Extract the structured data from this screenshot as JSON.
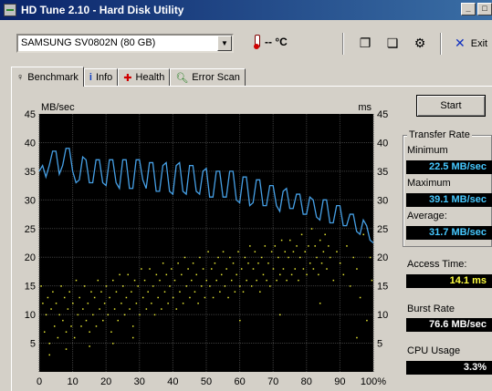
{
  "window": {
    "title": "HD Tune 2.10 - Hard Disk Utility",
    "minimize": "_",
    "maximize": "□"
  },
  "toolbar": {
    "drive": "SAMSUNG SV0802N (80 GB)",
    "temperature": "-- °C",
    "exit_label": "Exit"
  },
  "tabs": [
    {
      "label": "Benchmark",
      "icon": "benchmark-icon",
      "active": true
    },
    {
      "label": "Info",
      "icon": "info-icon"
    },
    {
      "label": "Health",
      "icon": "health-icon"
    },
    {
      "label": "Error Scan",
      "icon": "magnifier-icon"
    }
  ],
  "controls": {
    "start_label": "Start"
  },
  "stats": {
    "transfer_rate_title": "Transfer Rate",
    "minimum_label": "Minimum",
    "minimum_value": "22.5 MB/sec",
    "maximum_label": "Maximum",
    "maximum_value": "39.1 MB/sec",
    "average_label": "Average:",
    "average_value": "31.7 MB/sec",
    "access_time_label": "Access Time:",
    "access_time_value": "14.1 ms",
    "burst_rate_label": "Burst Rate",
    "burst_rate_value": "76.6 MB/sec",
    "cpu_usage_label": "CPU Usage",
    "cpu_usage_value": "3.3%"
  },
  "chart_data": {
    "type": "line",
    "ylabel_left": "MB/sec",
    "ylabel_right": "ms",
    "ylim": [
      0,
      45
    ],
    "yticks": [
      5,
      10,
      15,
      20,
      25,
      30,
      35,
      40,
      45
    ],
    "y2lim": [
      0,
      45
    ],
    "y2ticks": [
      5,
      10,
      15,
      20,
      25,
      30,
      35,
      40,
      45
    ],
    "xlim": [
      0,
      100
    ],
    "xticks": [
      "0",
      "10",
      "20",
      "30",
      "40",
      "50",
      "60",
      "70",
      "80",
      "90",
      "100%"
    ],
    "grid": true,
    "background": "#000000",
    "series": [
      {
        "color": "#46a0e6",
        "x": [
          0,
          1,
          2,
          3,
          4,
          5,
          6,
          7,
          8,
          9,
          10,
          11,
          12,
          13,
          14,
          15,
          16,
          17,
          18,
          19,
          20,
          21,
          22,
          23,
          24,
          25,
          26,
          27,
          28,
          29,
          30,
          31,
          32,
          33,
          34,
          35,
          36,
          37,
          38,
          39,
          40,
          41,
          42,
          43,
          44,
          45,
          46,
          47,
          48,
          49,
          50,
          51,
          52,
          53,
          54,
          55,
          56,
          57,
          58,
          59,
          60,
          61,
          62,
          63,
          64,
          65,
          66,
          67,
          68,
          69,
          70,
          71,
          72,
          73,
          74,
          75,
          76,
          77,
          78,
          79,
          80,
          81,
          82,
          83,
          84,
          85,
          86,
          87,
          88,
          89,
          90,
          91,
          92,
          93,
          94,
          95,
          96,
          97,
          98,
          99,
          100
        ],
        "values": [
          35,
          36,
          34,
          36,
          38.5,
          38.5,
          34.5,
          36,
          39,
          39,
          35,
          33,
          33.5,
          37.5,
          37,
          33,
          33,
          37,
          37,
          33,
          32.5,
          37,
          37,
          33,
          32,
          37,
          37,
          32,
          32,
          37,
          37,
          33.5,
          32,
          36.5,
          36.5,
          31.5,
          31.5,
          36,
          36.5,
          31.5,
          31,
          36,
          36.5,
          31.5,
          31,
          36,
          36,
          31.5,
          31,
          35,
          35.5,
          30.5,
          30.5,
          35,
          35,
          30.5,
          30.5,
          35,
          35,
          30,
          29.5,
          34,
          34,
          29,
          29.5,
          33.5,
          33.5,
          29,
          29,
          32.5,
          32.5,
          29,
          28,
          31.5,
          32,
          28.5,
          28.5,
          31,
          31,
          27.5,
          27.5,
          30.5,
          30,
          27,
          26.5,
          30,
          30,
          26,
          26,
          29,
          29,
          25.5,
          25.5,
          27.5,
          27.5,
          24.5,
          24,
          26.5,
          25.5,
          23,
          22.5
        ]
      },
      {
        "color": "#e6e632",
        "mode": "scatter",
        "points": [
          [
            0.5,
            15
          ],
          [
            1,
            12
          ],
          [
            1.5,
            7
          ],
          [
            2,
            10
          ],
          [
            2.5,
            13
          ],
          [
            3,
            5
          ],
          [
            3.5,
            11
          ],
          [
            4,
            14
          ],
          [
            4.5,
            8
          ],
          [
            5,
            12
          ],
          [
            5.5,
            6
          ],
          [
            6,
            10
          ],
          [
            6.5,
            15
          ],
          [
            7,
            9
          ],
          [
            7.5,
            13
          ],
          [
            8,
            7
          ],
          [
            8.5,
            11
          ],
          [
            9,
            14
          ],
          [
            9.5,
            8
          ],
          [
            10,
            12
          ],
          [
            10.5,
            6
          ],
          [
            11,
            16
          ],
          [
            11.5,
            10
          ],
          [
            12,
            13
          ],
          [
            12.5,
            8
          ],
          [
            13,
            11
          ],
          [
            13.5,
            15
          ],
          [
            14,
            9
          ],
          [
            14.5,
            12
          ],
          [
            15,
            7
          ],
          [
            15.5,
            14
          ],
          [
            16,
            10
          ],
          [
            16.5,
            13
          ],
          [
            17,
            8
          ],
          [
            17.5,
            16
          ],
          [
            18,
            11
          ],
          [
            18.5,
            14
          ],
          [
            19,
            9
          ],
          [
            19.5,
            12
          ],
          [
            20,
            15
          ],
          [
            20.5,
            10
          ],
          [
            21,
            13
          ],
          [
            21.5,
            7
          ],
          [
            22,
            16
          ],
          [
            22.5,
            11
          ],
          [
            23,
            14
          ],
          [
            23.5,
            9
          ],
          [
            24,
            17
          ],
          [
            24.5,
            12
          ],
          [
            25,
            15
          ],
          [
            25.5,
            10
          ],
          [
            26,
            13
          ],
          [
            26.5,
            17
          ],
          [
            27,
            11
          ],
          [
            27.5,
            14
          ],
          [
            28,
            8
          ],
          [
            28.5,
            16
          ],
          [
            29,
            12
          ],
          [
            29.5,
            15
          ],
          [
            30,
            10
          ],
          [
            30.5,
            18
          ],
          [
            31,
            13
          ],
          [
            31.5,
            16
          ],
          [
            32,
            11
          ],
          [
            32.5,
            14
          ],
          [
            33,
            18
          ],
          [
            33.5,
            12
          ],
          [
            34,
            15
          ],
          [
            34.5,
            10
          ],
          [
            35,
            17
          ],
          [
            35.5,
            13
          ],
          [
            36,
            16
          ],
          [
            36.5,
            11
          ],
          [
            37,
            19
          ],
          [
            37.5,
            14
          ],
          [
            38,
            17
          ],
          [
            38.5,
            12
          ],
          [
            39,
            15
          ],
          [
            39.5,
            18
          ],
          [
            40,
            13
          ],
          [
            40.5,
            16
          ],
          [
            41,
            11
          ],
          [
            41.5,
            19
          ],
          [
            42,
            14
          ],
          [
            42.5,
            17
          ],
          [
            43,
            12
          ],
          [
            43.5,
            20
          ],
          [
            44,
            15
          ],
          [
            44.5,
            18
          ],
          [
            45,
            13
          ],
          [
            45.5,
            16
          ],
          [
            46,
            19
          ],
          [
            46.5,
            14
          ],
          [
            47,
            17
          ],
          [
            47.5,
            12
          ],
          [
            48,
            20
          ],
          [
            48.5,
            15
          ],
          [
            49,
            18
          ],
          [
            49.5,
            13
          ],
          [
            50,
            16
          ],
          [
            50.5,
            21
          ],
          [
            51,
            15
          ],
          [
            51.5,
            18
          ],
          [
            52,
            13
          ],
          [
            52.5,
            19
          ],
          [
            53,
            16
          ],
          [
            53.5,
            20
          ],
          [
            54,
            14
          ],
          [
            54.5,
            17
          ],
          [
            55,
            21
          ],
          [
            55.5,
            15
          ],
          [
            56,
            18
          ],
          [
            56.5,
            13
          ],
          [
            57,
            20
          ],
          [
            57.5,
            16
          ],
          [
            58,
            19
          ],
          [
            58.5,
            14
          ],
          [
            59,
            17
          ],
          [
            59.5,
            21
          ],
          [
            60,
            15
          ],
          [
            60.5,
            18
          ],
          [
            61,
            14
          ],
          [
            61.5,
            20
          ],
          [
            62,
            16
          ],
          [
            62.5,
            19
          ],
          [
            63,
            22
          ],
          [
            63.5,
            15
          ],
          [
            64,
            18
          ],
          [
            64.5,
            21
          ],
          [
            65,
            16
          ],
          [
            65.5,
            19
          ],
          [
            66,
            14
          ],
          [
            66.5,
            20
          ],
          [
            67,
            17
          ],
          [
            67.5,
            22
          ],
          [
            68,
            16
          ],
          [
            68.5,
            19
          ],
          [
            69,
            15
          ],
          [
            69.5,
            21
          ],
          [
            70,
            18
          ],
          [
            70.5,
            22
          ],
          [
            71,
            16
          ],
          [
            71.5,
            20
          ],
          [
            72,
            17
          ],
          [
            72.5,
            23
          ],
          [
            73,
            18
          ],
          [
            73.5,
            21
          ],
          [
            74,
            16
          ],
          [
            74.5,
            20
          ],
          [
            75,
            23
          ],
          [
            75.5,
            17
          ],
          [
            76,
            21
          ],
          [
            76.5,
            18
          ],
          [
            77,
            22
          ],
          [
            77.5,
            16
          ],
          [
            78,
            20
          ],
          [
            78.5,
            24
          ],
          [
            79,
            18
          ],
          [
            79.5,
            21
          ],
          [
            80,
            17
          ],
          [
            80.5,
            22
          ],
          [
            81,
            19
          ],
          [
            81.5,
            25
          ],
          [
            82,
            18
          ],
          [
            82.5,
            22
          ],
          [
            83,
            20
          ],
          [
            83.5,
            17
          ],
          [
            84,
            23
          ],
          [
            84.5,
            19
          ],
          [
            85,
            21
          ],
          [
            85.5,
            24
          ],
          [
            86,
            18
          ],
          [
            86.5,
            22
          ],
          [
            87,
            20
          ],
          [
            88,
            16
          ],
          [
            89,
            21
          ],
          [
            90,
            19
          ],
          [
            91,
            17
          ],
          [
            92,
            22
          ],
          [
            93,
            15
          ],
          [
            94,
            20
          ],
          [
            95,
            18
          ],
          [
            96,
            13
          ],
          [
            97,
            24
          ],
          [
            98,
            9
          ],
          [
            99,
            20
          ],
          [
            99.5,
            16
          ],
          [
            3,
            3
          ],
          [
            8,
            4
          ],
          [
            15,
            4.5
          ],
          [
            22,
            5
          ],
          [
            28,
            6
          ],
          [
            60,
            9
          ],
          [
            72,
            10
          ],
          [
            84,
            12
          ],
          [
            95,
            6
          ]
        ]
      }
    ]
  }
}
